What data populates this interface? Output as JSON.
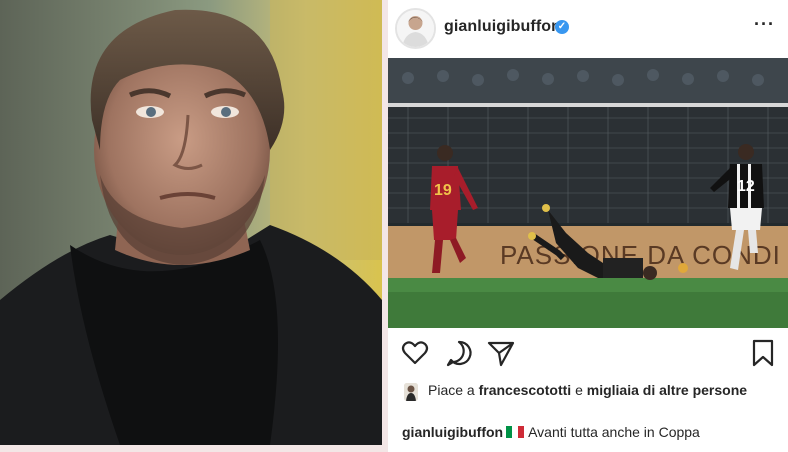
{
  "post": {
    "username": "gianluigibuffon",
    "verified_icon": "verified-badge-icon",
    "more_icon": "more-options-icon",
    "image_text": {
      "ad_banner": "PASSIONE DA CONDI",
      "player_left_number": "19",
      "player_right_number": "12"
    },
    "actions": [
      "heart-icon",
      "comment-icon",
      "share-icon",
      "bookmark-icon"
    ],
    "likes": {
      "prefix": "Piace a",
      "user": "francescototti",
      "connector": "e",
      "others": "migliaia di altre persone"
    },
    "caption": {
      "user": "gianluigibuffon",
      "text": "Avanti tutta anche in Coppa"
    }
  },
  "colors": {
    "accent_verified": "#3897f0",
    "text": "#262626",
    "roma_red": "#a81d2b",
    "juve_black": "#111111"
  }
}
